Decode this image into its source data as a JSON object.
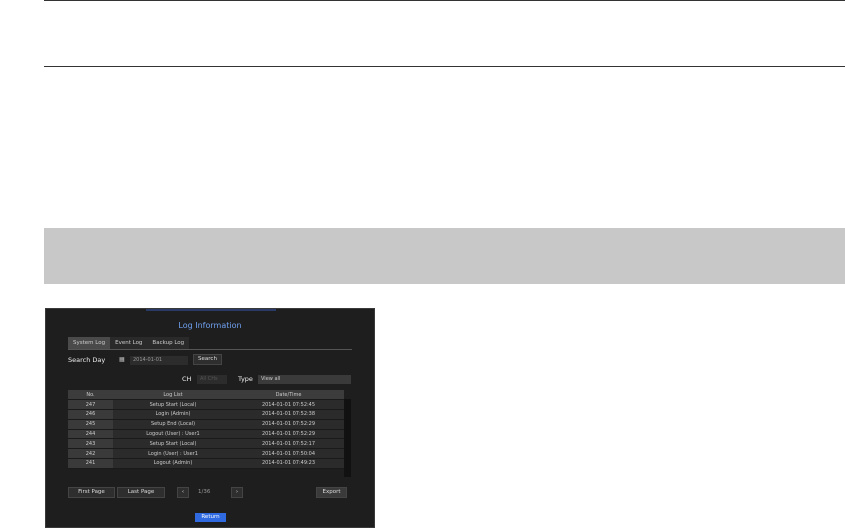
{
  "dialog": {
    "title": "Log Information",
    "tabs": [
      "System Log",
      "Event Log",
      "Backup Log"
    ],
    "search_day_label": "Search Day",
    "date_value": "2014-01-01",
    "search_label": "Search",
    "ch_label": "CH",
    "ch_value": "All CHs",
    "type_label": "Type",
    "type_value": "View all",
    "columns": [
      "No.",
      "Log List",
      "Date/Time"
    ],
    "rows": [
      [
        "247",
        "Setup Start (Local)",
        "2014-01-01 07:52:45"
      ],
      [
        "246",
        "Login (Admin)",
        "2014-01-01 07:52:38"
      ],
      [
        "245",
        "Setup End (Local)",
        "2014-01-01 07:52:29"
      ],
      [
        "244",
        "Logout (User) : User1",
        "2014-01-01 07:52:29"
      ],
      [
        "243",
        "Setup Start (Local)",
        "2014-01-01 07:52:17"
      ],
      [
        "242",
        "Login (User) : User1",
        "2014-01-01 07:50:04"
      ],
      [
        "241",
        "Logout (Admin)",
        "2014-01-01 07:49:23"
      ]
    ],
    "first_page": "First Page",
    "last_page": "Last Page",
    "page_indicator": "1/36",
    "export": "Export",
    "return": "Return"
  }
}
